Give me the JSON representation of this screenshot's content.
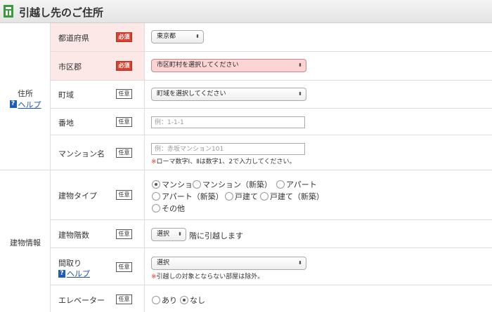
{
  "header": {
    "title": "引越し先のご住所"
  },
  "groups": {
    "address": {
      "label": "住所",
      "help": "ヘルプ"
    },
    "building": {
      "label": "建物情報"
    }
  },
  "badges": {
    "required": "必須",
    "optional": "任意"
  },
  "rows": {
    "prefecture": {
      "label": "都道府県",
      "value": "東京都"
    },
    "city": {
      "label": "市区郡",
      "value": "市区町村を選択してください"
    },
    "town": {
      "label": "町域",
      "value": "町域を選択してください"
    },
    "street": {
      "label": "番地",
      "placeholder": "例：1-1-1"
    },
    "mansion": {
      "label": "マンション名",
      "placeholder": "例：赤坂マンション101",
      "note_mark": "※",
      "note": "ローマ数字Ⅰ、Ⅱは数字1、2で入力してください。"
    },
    "building_type": {
      "label": "建物タイプ",
      "options": [
        "マンション",
        "マンション（新築）",
        "アパート",
        "アパート（新築）",
        "戸建て",
        "戸建て（新築）",
        "その他"
      ],
      "selected": "マンション"
    },
    "floor": {
      "label": "建物階数",
      "value": "選択",
      "suffix": "階に引越します"
    },
    "layout": {
      "label": "間取り",
      "help": "ヘルプ",
      "value": "選択",
      "note_mark": "※",
      "note": "引越しの対象とならない部屋は除外。"
    },
    "elevator": {
      "label": "エレベーター",
      "options": [
        "あり",
        "なし"
      ],
      "selected": "なし"
    }
  }
}
